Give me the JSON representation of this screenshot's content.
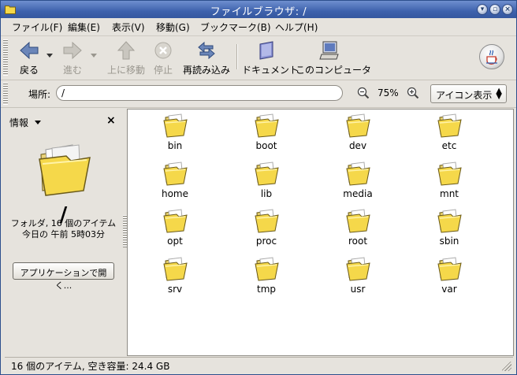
{
  "window": {
    "title": "ファイルブラウザ: /",
    "controls": [
      "minimize-icon",
      "maximize-icon",
      "close-icon"
    ]
  },
  "menubar": {
    "items": [
      "ファイル(F)",
      "編集(E)",
      "表示(V)",
      "移動(G)",
      "ブックマーク(B)",
      "ヘルプ(H)"
    ]
  },
  "toolbar": {
    "back": "戻る",
    "forward": "進む",
    "up": "上に移動",
    "stop": "停止",
    "reload": "再読み込み",
    "documents": "ドキュメント",
    "computer": "このコンピュータ"
  },
  "location": {
    "label": "場所:",
    "value": "/",
    "zoom_level": "75%",
    "view_mode": "アイコン表示"
  },
  "sidepane": {
    "title": "情報",
    "folder_name": "/",
    "info_line1": "フォルダ, 16 個のアイテム",
    "info_line2": "今日の 午前 5時03分",
    "open_button": "アプリケーションで開く..."
  },
  "files": [
    "bin",
    "boot",
    "dev",
    "etc",
    "home",
    "lib",
    "media",
    "mnt",
    "opt",
    "proc",
    "root",
    "sbin",
    "srv",
    "tmp",
    "usr",
    "var"
  ],
  "status": {
    "text": "16 個のアイテム, 空き容量: 24.4 GB"
  },
  "colors": {
    "titlebar": "#3e62ad",
    "folder": "#f2d544"
  }
}
